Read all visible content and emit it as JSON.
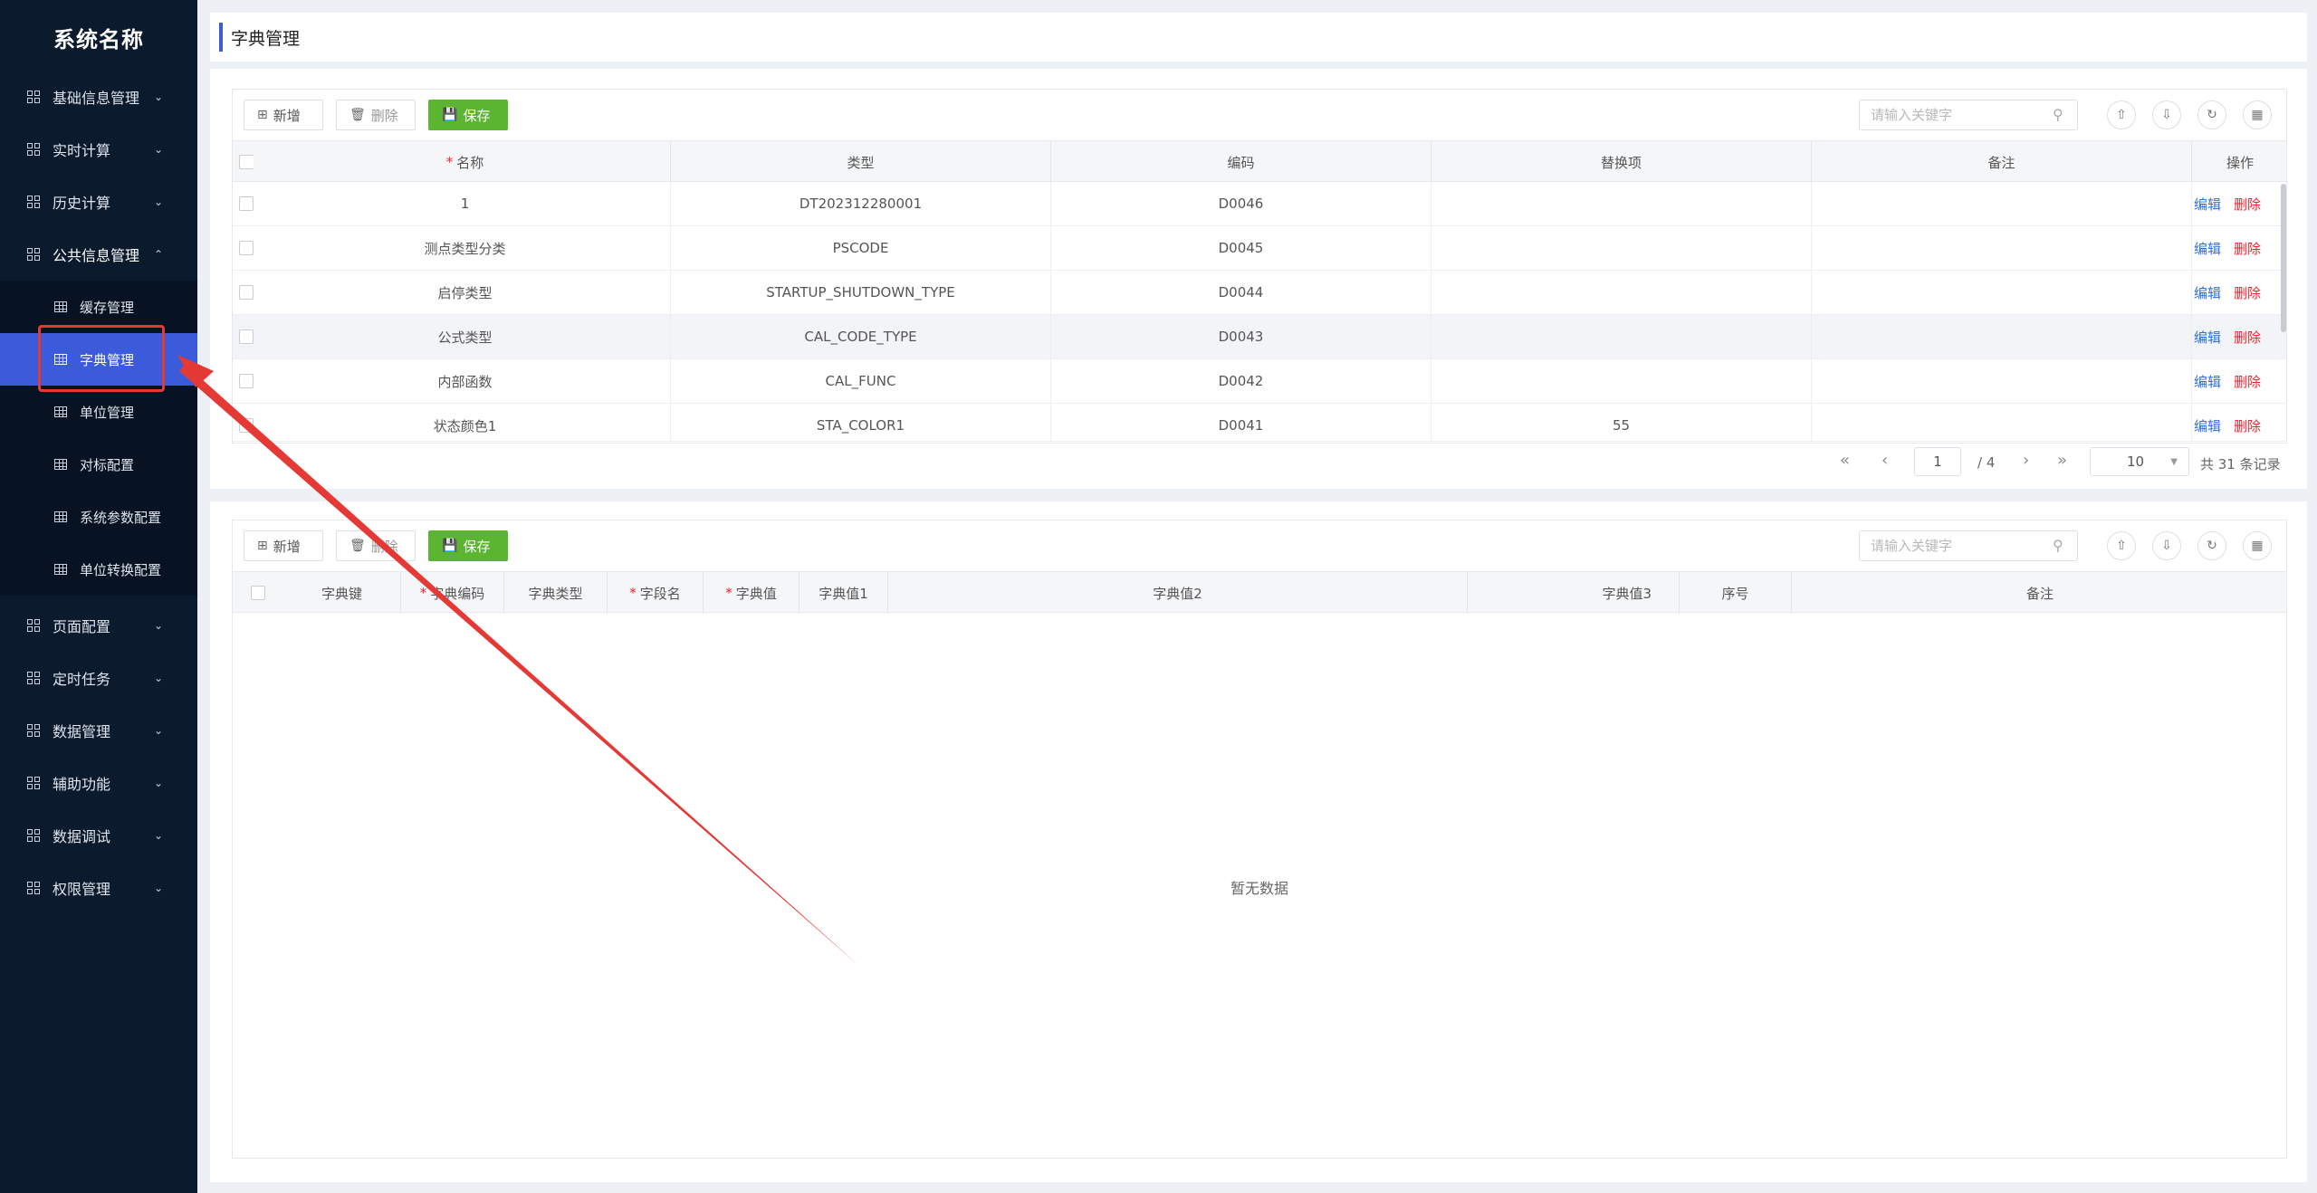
{
  "app": {
    "brand": "系统名称",
    "page_title": "字典管理"
  },
  "sidebar": {
    "groups": [
      {
        "label": "基础信息管理",
        "expanded": false
      },
      {
        "label": "实时计算",
        "expanded": false
      },
      {
        "label": "历史计算",
        "expanded": false
      },
      {
        "label": "公共信息管理",
        "expanded": true
      },
      {
        "label": "页面配置",
        "expanded": false
      },
      {
        "label": "定时任务",
        "expanded": false
      },
      {
        "label": "数据管理",
        "expanded": false
      },
      {
        "label": "辅助功能",
        "expanded": false
      },
      {
        "label": "数据调试",
        "expanded": false
      },
      {
        "label": "权限管理",
        "expanded": false
      }
    ],
    "sub_items": [
      {
        "label": "缓存管理",
        "active": false
      },
      {
        "label": "字典管理",
        "active": true
      },
      {
        "label": "单位管理",
        "active": false
      },
      {
        "label": "对标配置",
        "active": false
      },
      {
        "label": "系统参数配置",
        "active": false
      },
      {
        "label": "单位转换配置",
        "active": false
      }
    ]
  },
  "toolbar": {
    "add": "新增",
    "delete": "删除",
    "save": "保存",
    "search_placeholder": "请输入关键字"
  },
  "dict_table": {
    "columns": [
      "名称",
      "类型",
      "编码",
      "替换项",
      "备注",
      "操作"
    ],
    "rows": [
      {
        "name": "1",
        "type": "DT202312280001",
        "code": "D0046",
        "replace": "",
        "remark": ""
      },
      {
        "name": "测点类型分类",
        "type": "PSCODE",
        "code": "D0045",
        "replace": "",
        "remark": ""
      },
      {
        "name": "启停类型",
        "type": "STARTUP_SHUTDOWN_TYPE",
        "code": "D0044",
        "replace": "",
        "remark": ""
      },
      {
        "name": "公式类型",
        "type": "CAL_CODE_TYPE",
        "code": "D0043",
        "replace": "",
        "remark": ""
      },
      {
        "name": "内部函数",
        "type": "CAL_FUNC",
        "code": "D0042",
        "replace": "",
        "remark": ""
      },
      {
        "name": "状态颜色1",
        "type": "STA_COLOR1",
        "code": "D0041",
        "replace": "55",
        "remark": ""
      }
    ],
    "actions": {
      "edit": "编辑",
      "delete": "删除"
    },
    "pagination": {
      "current": "1",
      "total_pages": "/ 4",
      "page_size": "10",
      "total": "共 31 条记录"
    }
  },
  "item_table": {
    "columns": [
      "字典键",
      "字典编码",
      "字典类型",
      "字段名",
      "字典值",
      "字典值1",
      "字典值2",
      "字典值3",
      "序号",
      "备注"
    ],
    "empty_text": "暂无数据"
  },
  "colors": {
    "sidebar_bg": "#0c1a2e",
    "accent": "#3b5bdb",
    "save_green": "#5cb531",
    "danger": "#f5222d",
    "annotation_red": "#e53935"
  }
}
